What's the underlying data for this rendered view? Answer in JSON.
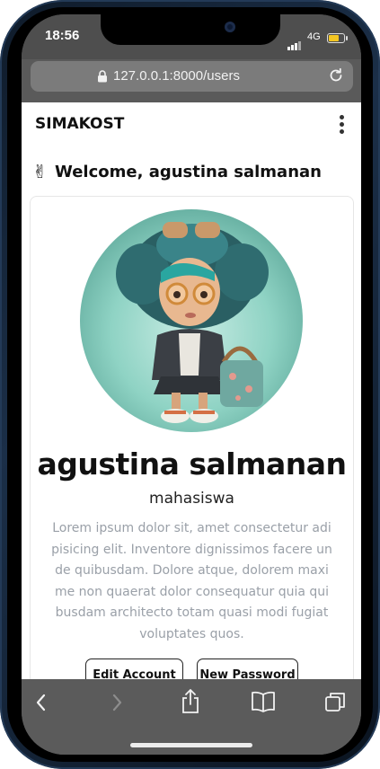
{
  "status_bar": {
    "time": "18:56",
    "network": "4G"
  },
  "browser": {
    "url": "127.0.0.1:8000/users"
  },
  "navbar": {
    "brand": "SIMAKOST"
  },
  "welcome": {
    "emoji": "✌",
    "text": "Welcome, agustina salmanan"
  },
  "profile": {
    "name": "agustina salmanan",
    "role": "mahasiswa",
    "bio": "Lorem ipsum dolor sit, amet consectetur adi pisicing elit. Inventore dignissimos facere un de quibusdam. Dolore atque, dolorem maxi me non quaerat dolor consequatur quia qui busdam architecto totam quasi modi fugiat voluptates quos.",
    "buttons": {
      "edit": "Edit Account",
      "password": "New Password"
    }
  },
  "toolbar": {
    "icons": [
      "back-icon",
      "forward-icon",
      "share-icon",
      "bookmarks-icon",
      "tabs-icon"
    ]
  },
  "colors": {
    "accent_battery": "#f3c623",
    "bio_text": "#9aa0a8",
    "browser_chrome": "#5b5b5b"
  }
}
